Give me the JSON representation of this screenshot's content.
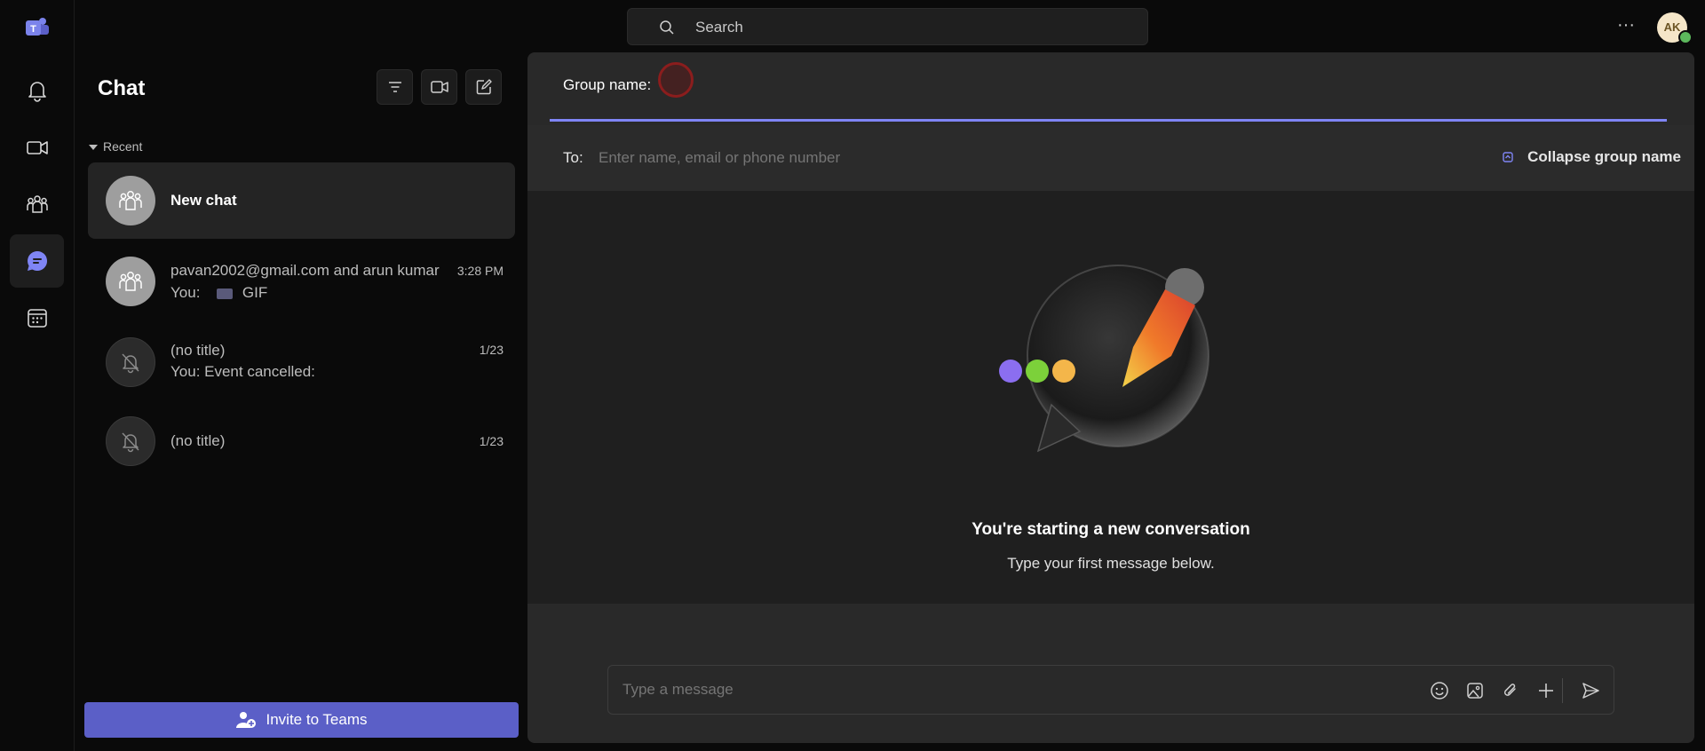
{
  "colors": {
    "accent": "#5b5fc7",
    "underline": "#7f85f5",
    "presence": "#5cb85c",
    "teams_logo": "#7b83eb"
  },
  "topbar": {
    "search_placeholder": "Search",
    "more_label": "···",
    "avatar_initials": "AK"
  },
  "rail": {
    "items": [
      {
        "icon": "bell-icon",
        "active": false
      },
      {
        "icon": "video-icon",
        "active": false
      },
      {
        "icon": "people-icon",
        "active": false
      },
      {
        "icon": "chat-bubble-icon",
        "active": true
      },
      {
        "icon": "calendar-icon",
        "active": false
      }
    ]
  },
  "chat_list": {
    "title": "Chat",
    "header_icons": [
      "filter-icon",
      "video-icon",
      "compose-icon"
    ],
    "section": "Recent",
    "items": [
      {
        "name": "New chat",
        "subtitle": "",
        "time": "",
        "avatar": "group-icon"
      },
      {
        "name": "pavan2002@gmail.com and arun kumar",
        "subtitle_prefix": "You:",
        "subtitle": "GIF",
        "time": "3:28 PM",
        "avatar": "group-icon"
      },
      {
        "name": "(no title)",
        "subtitle": "You: Event cancelled:",
        "time": "1/23",
        "avatar": "bell-off-icon"
      },
      {
        "name": "(no title)",
        "subtitle": "",
        "time": "1/23",
        "avatar": "bell-off-icon"
      }
    ],
    "invite_label": "Invite to Teams"
  },
  "conversation": {
    "group_name_label": "Group name:",
    "to_label": "To:",
    "to_placeholder": "Enter name, email or phone number",
    "collapse_label": "Collapse group name",
    "hero_title": "You're starting a new conversation",
    "hero_subtitle": "Type your first message below.",
    "compose_placeholder": "Type a message",
    "compose_icons": [
      "emoji-icon",
      "image-icon",
      "attach-icon",
      "plus-icon",
      "send-icon"
    ]
  }
}
